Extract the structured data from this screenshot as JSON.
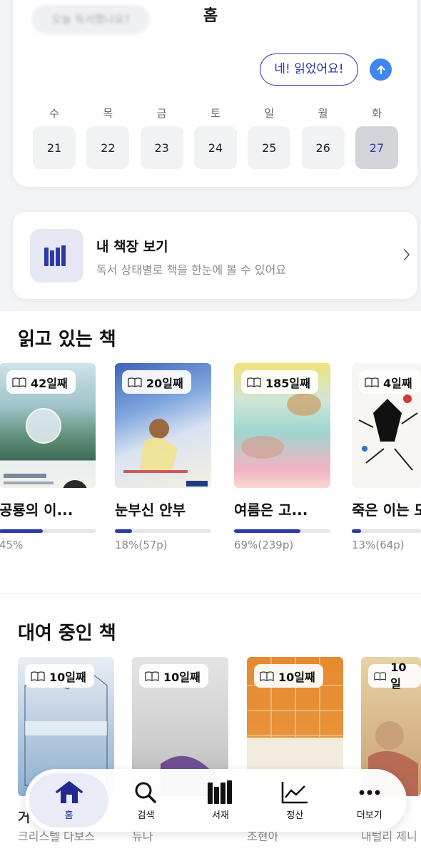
{
  "header": {
    "title": "홈",
    "blurred_question": "오늘 독서했나요?"
  },
  "reply": {
    "label": "네! 읽었어요!"
  },
  "calendar": {
    "days": [
      {
        "weekday": "수",
        "date": "21"
      },
      {
        "weekday": "목",
        "date": "22"
      },
      {
        "weekday": "금",
        "date": "23"
      },
      {
        "weekday": "토",
        "date": "24"
      },
      {
        "weekday": "일",
        "date": "25"
      },
      {
        "weekday": "월",
        "date": "26"
      },
      {
        "weekday": "화",
        "date": "27"
      }
    ],
    "today_index": 6
  },
  "bookshelf": {
    "title": "내 책장 보기",
    "subtitle": "독서 상태별로 책을 한눈에 볼 수 있어요"
  },
  "reading": {
    "title": "읽고 있는 책",
    "books": [
      {
        "badge": "42일째",
        "title": "공룡의 이...",
        "progress": 0.45,
        "progress_text": "45%"
      },
      {
        "badge": "20일째",
        "title": "눈부신 안부",
        "progress": 0.18,
        "progress_text": "18%(57p)"
      },
      {
        "badge": "185일째",
        "title": "여름은 고...",
        "progress": 0.69,
        "progress_text": "69%(239p)"
      },
      {
        "badge": "4일째",
        "title": "죽은 이는 모",
        "progress": 0.13,
        "progress_text": "13%(64p)"
      }
    ]
  },
  "lending": {
    "title": "대여 중인 책",
    "books": [
      {
        "badge": "10일째",
        "title": "거",
        "author": "크리스텔 다보스"
      },
      {
        "badge": "10일째",
        "title": "",
        "author": "듀나"
      },
      {
        "badge": "10일째",
        "title": "",
        "author": "조현아"
      },
      {
        "badge": "10일",
        "title": "",
        "author": "내털리 제니"
      }
    ]
  },
  "nav": {
    "items": [
      {
        "label": "홈",
        "icon": "home-icon"
      },
      {
        "label": "검색",
        "icon": "search-icon"
      },
      {
        "label": "서재",
        "icon": "library-icon"
      },
      {
        "label": "정산",
        "icon": "chart-icon"
      },
      {
        "label": "더보기",
        "icon": "more-icon"
      }
    ]
  },
  "colors": {
    "accent": "#2c3aa8",
    "send": "#3f86f2"
  }
}
